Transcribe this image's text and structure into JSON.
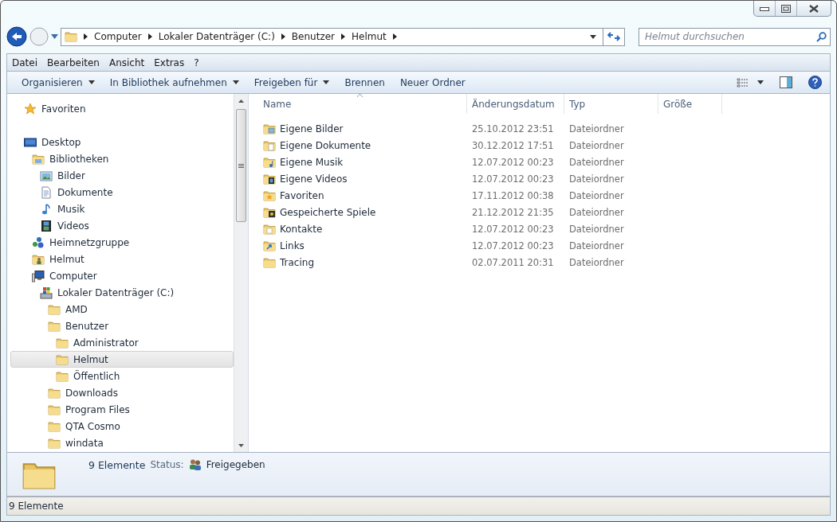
{
  "address_bar": {
    "segments": [
      "Computer",
      "Lokaler Datenträger (C:)",
      "Benutzer",
      "Helmut"
    ]
  },
  "search": {
    "placeholder": "Helmut durchsuchen"
  },
  "menu_bar": [
    "Datei",
    "Bearbeiten",
    "Ansicht",
    "Extras",
    "?"
  ],
  "toolbar": [
    {
      "label": "Organisieren",
      "has_menu": true
    },
    {
      "label": "In Bibliothek aufnehmen",
      "has_menu": true
    },
    {
      "label": "Freigeben für",
      "has_menu": true
    },
    {
      "label": "Brennen",
      "has_menu": false
    },
    {
      "label": "Neuer Ordner",
      "has_menu": false
    }
  ],
  "navigation": [
    {
      "label": "Favoriten",
      "kind": "star",
      "selected": false
    },
    {
      "label": "Desktop",
      "kind": "desktop",
      "selected": false,
      "children": [
        {
          "label": "Bibliotheken",
          "kind": "library",
          "selected": false,
          "children": [
            {
              "label": "Bilder",
              "kind": "pictures",
              "selected": false
            },
            {
              "label": "Dokumente",
              "kind": "documents",
              "selected": false
            },
            {
              "label": "Musik",
              "kind": "music",
              "selected": false
            },
            {
              "label": "Videos",
              "kind": "videos",
              "selected": false
            }
          ]
        },
        {
          "label": "Heimnetzgruppe",
          "kind": "homegroup",
          "selected": false
        },
        {
          "label": "Helmut",
          "kind": "user",
          "selected": false
        },
        {
          "label": "Computer",
          "kind": "computer",
          "selected": false,
          "children": [
            {
              "label": "Lokaler Datenträger (C:)",
              "kind": "drive",
              "selected": false,
              "children": [
                {
                  "label": "AMD",
                  "kind": "folder",
                  "selected": false
                },
                {
                  "label": "Benutzer",
                  "kind": "folder",
                  "selected": false,
                  "children": [
                    {
                      "label": "Administrator",
                      "kind": "folder",
                      "selected": false
                    },
                    {
                      "label": "Helmut",
                      "kind": "folder",
                      "selected": true
                    },
                    {
                      "label": "Öffentlich",
                      "kind": "folder",
                      "selected": false
                    }
                  ]
                },
                {
                  "label": "Downloads",
                  "kind": "folder",
                  "selected": false
                },
                {
                  "label": "Program Files",
                  "kind": "folder",
                  "selected": false
                },
                {
                  "label": "QTA Cosmo",
                  "kind": "folder",
                  "selected": false
                },
                {
                  "label": "windata",
                  "kind": "folder",
                  "selected": false
                }
              ]
            }
          ]
        }
      ]
    }
  ],
  "file_list": {
    "columns": [
      "Name",
      "Änderungsdatum",
      "Typ",
      "Größe"
    ],
    "rows": [
      {
        "name": "Eigene Bilder",
        "kind": "pictures",
        "date": "25.10.2012 23:51",
        "type": "Dateiordner"
      },
      {
        "name": "Eigene Dokumente",
        "kind": "documents",
        "date": "30.12.2012 17:51",
        "type": "Dateiordner"
      },
      {
        "name": "Eigene Musik",
        "kind": "music",
        "date": "12.07.2012 00:23",
        "type": "Dateiordner"
      },
      {
        "name": "Eigene Videos",
        "kind": "videos",
        "date": "12.07.2012 00:23",
        "type": "Dateiordner"
      },
      {
        "name": "Favoriten",
        "kind": "favorites",
        "date": "17.11.2012 00:38",
        "type": "Dateiordner"
      },
      {
        "name": "Gespeicherte Spiele",
        "kind": "games",
        "date": "21.12.2012 21:35",
        "type": "Dateiordner"
      },
      {
        "name": "Kontakte",
        "kind": "contacts",
        "date": "12.07.2012 00:23",
        "type": "Dateiordner"
      },
      {
        "name": "Links",
        "kind": "links",
        "date": "12.07.2012 00:23",
        "type": "Dateiordner"
      },
      {
        "name": "Tracing",
        "kind": "folder",
        "date": "02.07.2011 20:31",
        "type": "Dateiordner"
      }
    ]
  },
  "details_pane": {
    "count": "9 Elemente",
    "status_label": "Status:",
    "status": "Freigegeben"
  },
  "status_bar": "9 Elemente"
}
